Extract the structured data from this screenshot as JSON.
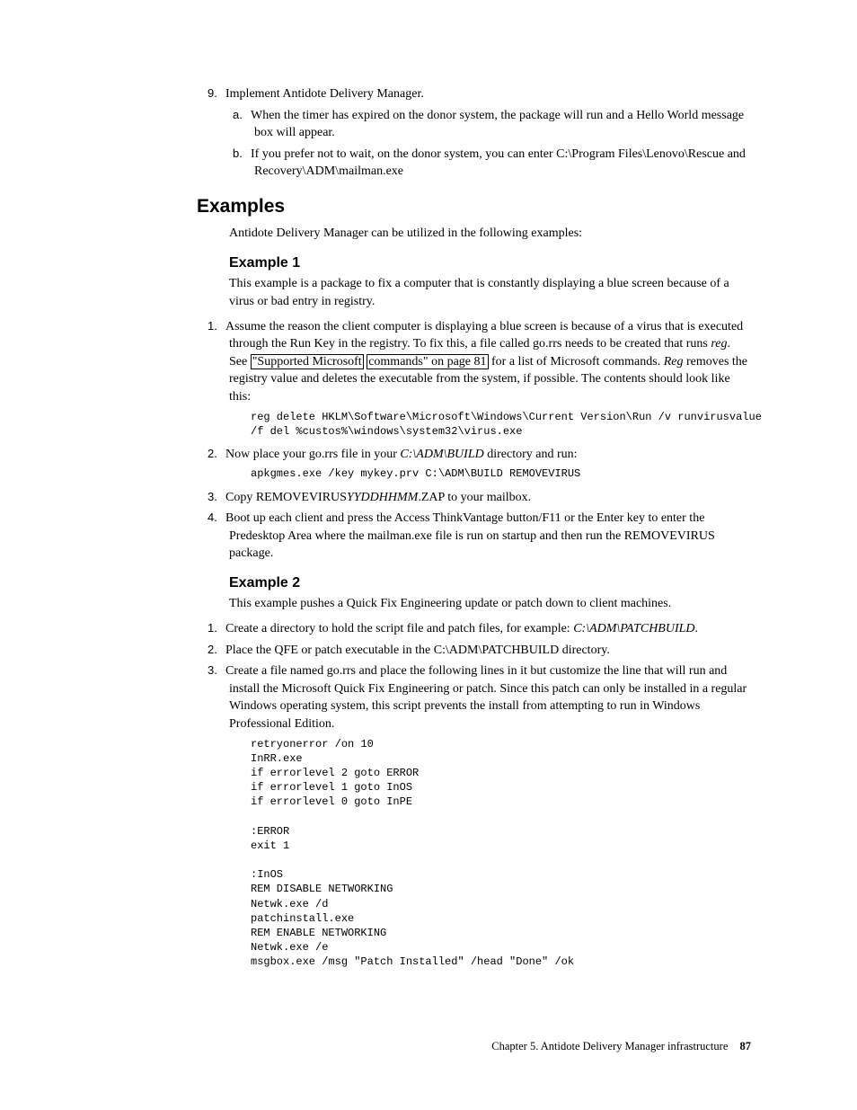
{
  "step9": {
    "num": "9.",
    "text": "Implement Antidote Delivery Manager.",
    "a": {
      "num": "a.",
      "text": "When the timer has expired on the donor system, the package will run and a Hello World message box will appear."
    },
    "b": {
      "num": "b.",
      "text": "If you prefer not to wait, on the donor system, you can enter C:\\Program Files\\Lenovo\\Rescue and Recovery\\ADM\\mailman.exe"
    }
  },
  "examples": {
    "heading": "Examples",
    "intro": "Antidote Delivery Manager can be utilized in the following examples:"
  },
  "ex1": {
    "heading": "Example 1",
    "intro": "This example is a package to fix a computer that is constantly displaying a blue screen because of a virus or bad entry in registry.",
    "s1": {
      "num": "1.",
      "t1": "Assume the reason the client computer is displaying a blue screen is because of a virus that is executed through the Run Key in the registry. To fix this, a file called go.rrs needs to be created that runs ",
      "reg": "reg",
      "t2": ". See ",
      "link1": "\"Supported Microsoft",
      "link2": "commands\" on page 81",
      "t3": " for a list of Microsoft commands. ",
      "reg2": "Reg",
      "t4": " removes the registry value and deletes the executable from the system, if possible. The contents should look like this:",
      "code": "reg delete HKLM\\Software\\Microsoft\\Windows\\Current Version\\Run /v runvirusvalue\n/f del %custos%\\windows\\system32\\virus.exe"
    },
    "s2": {
      "num": "2.",
      "t1": "Now place your go.rrs file in your ",
      "path": "C:\\ADM\\BUILD",
      "t2": " directory and run:",
      "code": "apkgmes.exe /key mykey.prv C:\\ADM\\BUILD REMOVEVIRUS"
    },
    "s3": {
      "num": "3.",
      "t1": "Copy REMOVEVIRUS",
      "yy": "YYDDHHMM",
      "t2": ".ZAP to your mailbox."
    },
    "s4": {
      "num": "4.",
      "text": "Boot up each client and press the Access ThinkVantage button/F11 or the Enter key to enter the Predesktop Area where the mailman.exe file is run on startup and then run the REMOVEVIRUS package."
    }
  },
  "ex2": {
    "heading": "Example 2",
    "intro": "This example pushes a Quick Fix Engineering update or patch down to client machines.",
    "s1": {
      "num": "1.",
      "t1": "Create a directory to hold the script file and patch files, for example: ",
      "path": "C:\\ADM\\PATCHBUILD",
      "t2": "."
    },
    "s2": {
      "num": "2.",
      "text": "Place the QFE or patch executable in the C:\\ADM\\PATCHBUILD directory."
    },
    "s3": {
      "num": "3.",
      "text": "Create a file named go.rrs and place the following lines in it but customize the line that will run and install the Microsoft Quick Fix Engineering or patch. Since this patch can only be installed in a regular Windows operating system, this script prevents the install from attempting to run in Windows Professional Edition.",
      "code": "retryonerror /on 10\nInRR.exe\nif errorlevel 2 goto ERROR\nif errorlevel 1 goto InOS\nif errorlevel 0 goto InPE\n\n:ERROR\nexit 1\n\n:InOS\nREM DISABLE NETWORKING\nNetwk.exe /d\npatchinstall.exe\nREM ENABLE NETWORKING\nNetwk.exe /e\nmsgbox.exe /msg \"Patch Installed\" /head \"Done\" /ok"
    }
  },
  "footer": {
    "chapter": "Chapter 5. Antidote Delivery Manager infrastructure",
    "page": "87"
  }
}
